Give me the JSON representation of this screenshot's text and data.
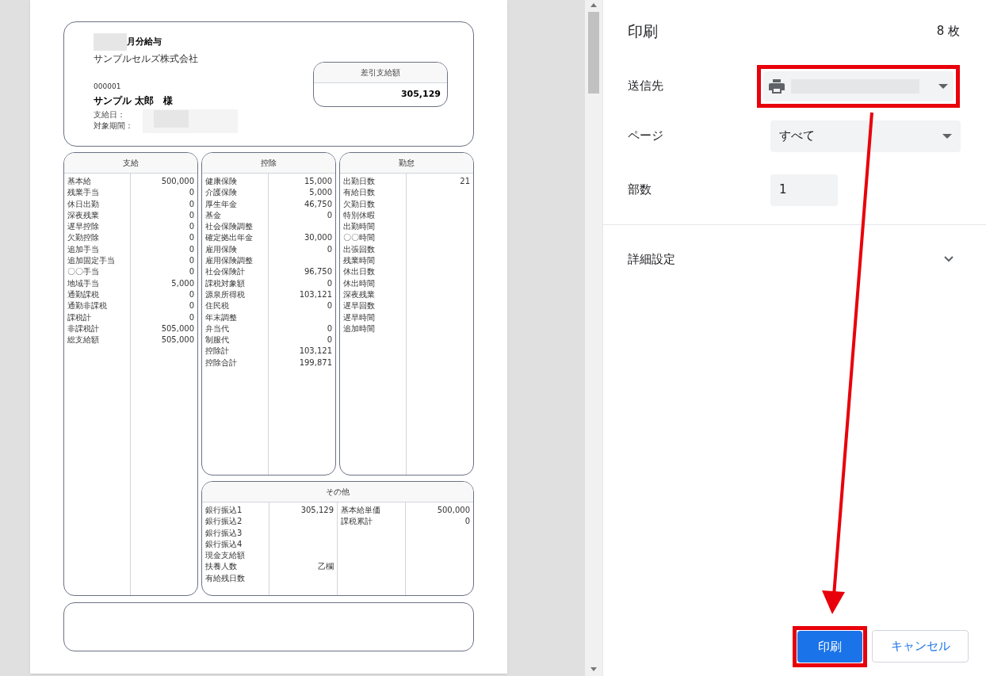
{
  "payslip": {
    "title": "月分給与",
    "company": "サンプルセルズ株式会社",
    "employee_id": "000001",
    "employee_name": "サンプル 太郎　様",
    "pay_date_label": "支給日：",
    "period_label": "対象期間：",
    "net_pay": {
      "label": "差引支給額",
      "value": "305,129"
    },
    "sections": [
      {
        "title": "支給",
        "rows": [
          {
            "label": "基本給",
            "value": "500,000"
          },
          {
            "label": "残業手当",
            "value": "0"
          },
          {
            "label": "休日出勤",
            "value": "0"
          },
          {
            "label": "深夜残業",
            "value": "0"
          },
          {
            "label": "遅早控除",
            "value": "0"
          },
          {
            "label": "欠勤控除",
            "value": "0"
          },
          {
            "label": "追加手当",
            "value": "0"
          },
          {
            "label": "追加固定手当",
            "value": "0"
          },
          {
            "label": "〇〇手当",
            "value": "0"
          },
          {
            "label": "地域手当",
            "value": "5,000"
          },
          {
            "label": "通勤課税",
            "value": "0"
          },
          {
            "label": "通勤非課税",
            "value": "0"
          },
          {
            "label": "課税計",
            "value": "0"
          },
          {
            "label": "非課税計",
            "value": "505,000"
          },
          {
            "label": "総支給額",
            "value": "505,000"
          }
        ]
      },
      {
        "title": "控除",
        "rows": [
          {
            "label": "健康保険",
            "value": "15,000"
          },
          {
            "label": "介護保険",
            "value": "5,000"
          },
          {
            "label": "厚生年金",
            "value": "46,750"
          },
          {
            "label": "基金",
            "value": "0"
          },
          {
            "label": "社会保険調整"
          },
          {
            "label": "確定拠出年金",
            "value": "30,000"
          },
          {
            "label": "雇用保険",
            "value": "0"
          },
          {
            "label": "雇用保険調整"
          },
          {
            "label": "社会保険計",
            "value": "96,750"
          },
          {
            "label": "課税対象額",
            "value": "0"
          },
          {
            "label": "源泉所得税",
            "value": "103,121"
          },
          {
            "label": "住民税",
            "value": "0"
          },
          {
            "label": "年末調整"
          },
          {
            "label": "弁当代",
            "value": "0"
          },
          {
            "label": "制服代",
            "value": "0"
          },
          {
            "label": "控除計",
            "value": "103,121"
          },
          {
            "label": "控除合計",
            "value": "199,871"
          }
        ]
      },
      {
        "title": "勤怠",
        "rows": [
          {
            "label": "出勤日数",
            "value": "21"
          },
          {
            "label": "有給日数"
          },
          {
            "label": "欠勤日数"
          },
          {
            "label": "特別休暇"
          },
          {
            "label": "出勤時間"
          },
          {
            "label": "〇〇時間"
          },
          {
            "label": "出張回数"
          },
          {
            "label": "残業時間"
          },
          {
            "label": "休出日数"
          },
          {
            "label": "休出時間"
          },
          {
            "label": "深夜残業"
          },
          {
            "label": "遅早回数"
          },
          {
            "label": "遅早時間"
          },
          {
            "label": "追加時間"
          }
        ]
      }
    ],
    "other": {
      "title": "その他",
      "columns": [
        [
          {
            "label": "銀行振込1",
            "value": "305,129"
          },
          {
            "label": "銀行振込2"
          },
          {
            "label": "銀行振込3"
          },
          {
            "label": "銀行振込4"
          },
          {
            "label": "現金支給額"
          },
          {
            "label": "扶養人数",
            "value": "乙欄"
          },
          {
            "label": "有給残日数"
          }
        ],
        [
          {
            "label": "基本給単価",
            "value": "500,000"
          },
          {
            "label": "課税累計",
            "value": "0"
          }
        ]
      ]
    }
  },
  "print_panel": {
    "title": "印刷",
    "sheet_count": "8 枚",
    "destination": {
      "label": "送信先"
    },
    "pages": {
      "label": "ページ",
      "value": "すべて"
    },
    "copies": {
      "label": "部数",
      "value": "1"
    },
    "more_settings": {
      "label": "詳細設定",
      "expanded": false
    },
    "buttons": [
      {
        "label": "印刷",
        "kind": "primary"
      },
      {
        "label": "キャンセル",
        "kind": "secondary"
      }
    ]
  }
}
